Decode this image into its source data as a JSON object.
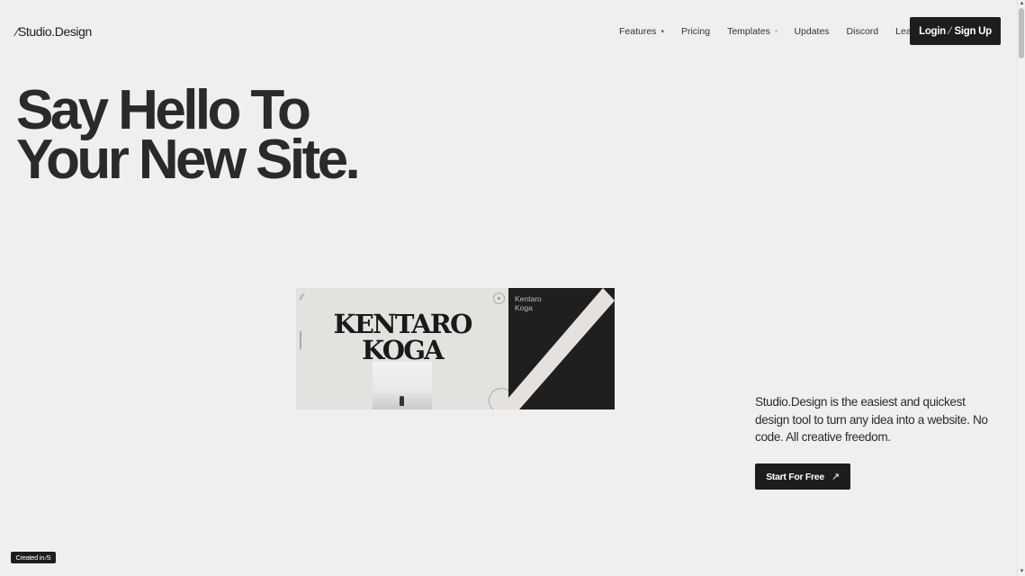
{
  "header": {
    "logo_slash": "⁄",
    "logo_text": "Studio.Design",
    "nav": [
      {
        "label": "Features",
        "dropdown": true
      },
      {
        "label": "Pricing"
      },
      {
        "label": "Templates",
        "dropdown": true
      },
      {
        "label": "Updates"
      },
      {
        "label": "Discord"
      },
      {
        "label": "Learn"
      }
    ],
    "login_label": "Login",
    "slash": "⁄",
    "signup_label": "Sign Up"
  },
  "hero": {
    "line1": "Say Hello To",
    "line2": "Your New Site."
  },
  "preview": {
    "title_line1": "KENTARO",
    "title_line2": "KOGA",
    "dark_line1": "Kentaro",
    "dark_line2": "Koga"
  },
  "description": "Studio.Design is the easiest and quickest design tool to turn any idea into a website. No code. All creative freedom.",
  "cta": {
    "label": "Start For Free",
    "arrow": "↗"
  },
  "badge": "Created in ⁄S",
  "colors": {
    "background": "#efefef",
    "button": "#1d1d1d",
    "text": "#222222"
  }
}
